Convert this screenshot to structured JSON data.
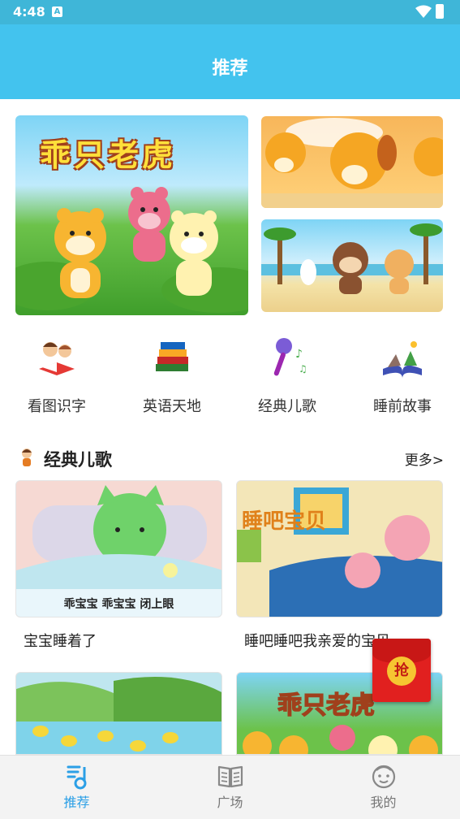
{
  "status_bar": {
    "time": "4:48",
    "notification_letter": "A"
  },
  "header": {
    "title": "推荐"
  },
  "banners": [
    {
      "title": "乖只老虎"
    },
    {
      "title": ""
    },
    {
      "title": ""
    }
  ],
  "quick_nav": [
    {
      "label": "看图识字",
      "icon": "kids-reading-icon"
    },
    {
      "label": "英语天地",
      "icon": "books-icon"
    },
    {
      "label": "经典儿歌",
      "icon": "microphone-icon"
    },
    {
      "label": "睡前故事",
      "icon": "storybook-icon"
    }
  ],
  "section": {
    "title": "经典儿歌",
    "more": "更多>"
  },
  "cards": [
    {
      "title": "宝宝睡着了",
      "caption": "乖宝宝 乖宝宝 闭上眼"
    },
    {
      "title": "睡吧睡吧我亲爱的宝贝",
      "thumb_text": "睡吧宝贝"
    },
    {
      "title": ""
    },
    {
      "title": "",
      "thumb_text": "乖只老虎"
    }
  ],
  "red_packet": {
    "label": "抢"
  },
  "tabbar": [
    {
      "label": "推荐",
      "active": true
    },
    {
      "label": "广场",
      "active": false
    },
    {
      "label": "我的",
      "active": false
    }
  ],
  "colors": {
    "header": "#43c3ee",
    "status_bar": "#3fb6d8",
    "active_tab": "#2b9fe6",
    "red_packet": "#e1201f"
  }
}
